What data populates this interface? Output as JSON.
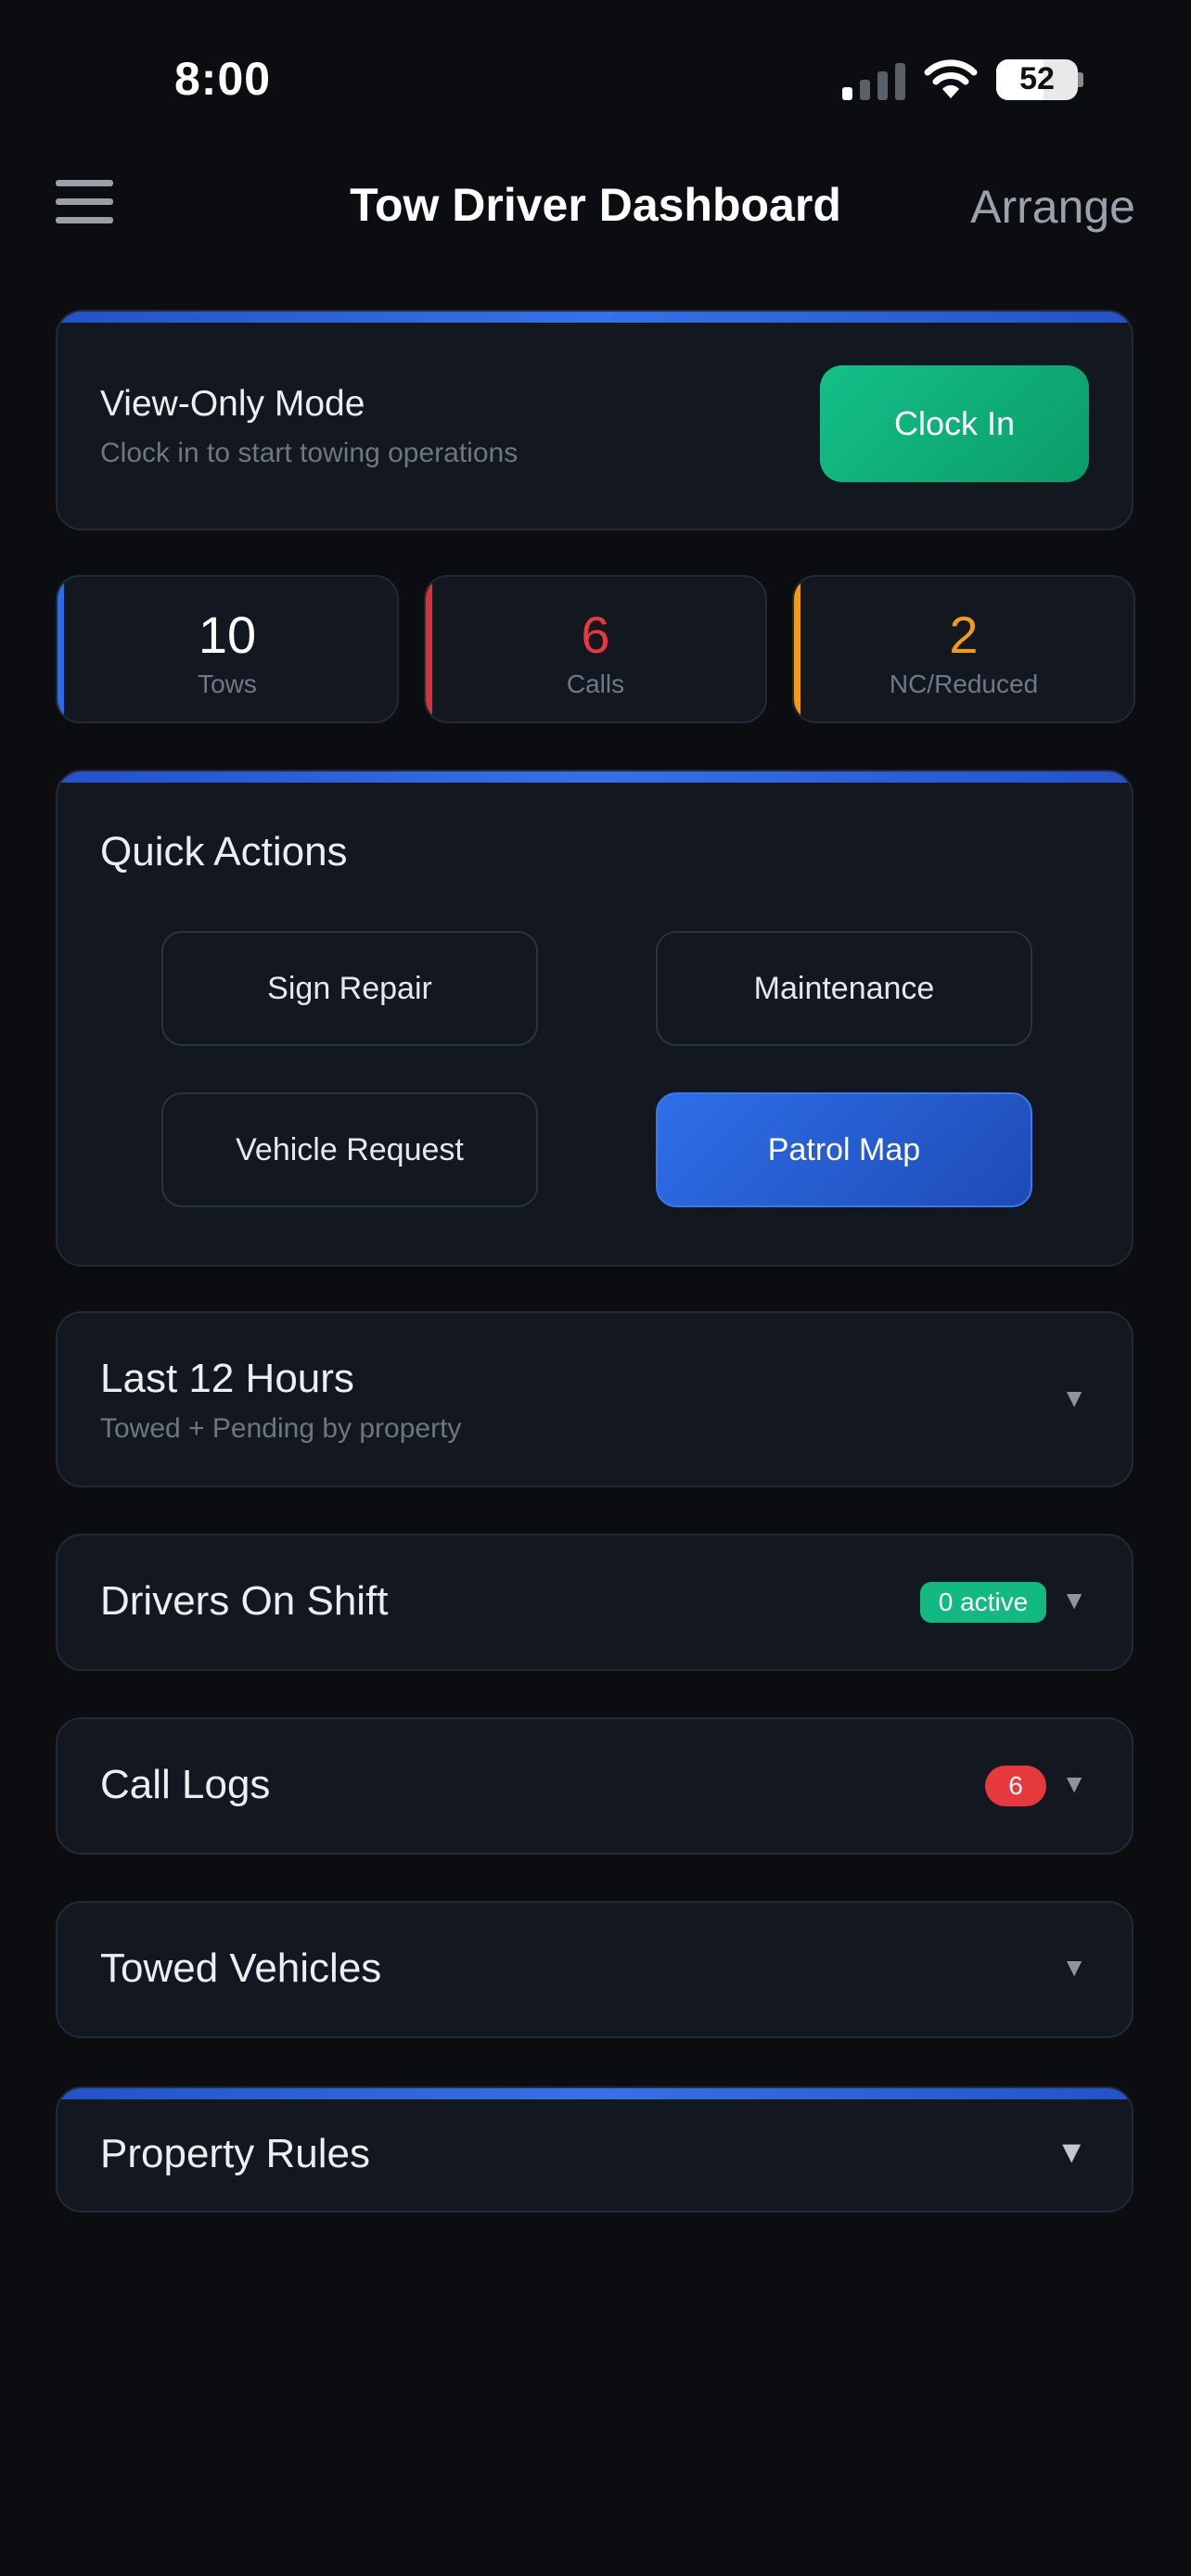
{
  "status_bar": {
    "time": "8:00",
    "battery": "52"
  },
  "header": {
    "title": "Tow Driver Dashboard",
    "arrange_label": "Arrange"
  },
  "mode_card": {
    "title": "View-Only Mode",
    "subtitle": "Clock in to start towing operations",
    "clock_in_label": "Clock In"
  },
  "stats": [
    {
      "value": "10",
      "label": "Tows",
      "color": "#ffffff",
      "accent": "#2f6be0"
    },
    {
      "value": "6",
      "label": "Calls",
      "color": "#e5393d",
      "accent": "#d83236"
    },
    {
      "value": "2",
      "label": "NC/Reduced",
      "color": "#f39a1a",
      "accent": "#f39a1a"
    }
  ],
  "quick_actions": {
    "title": "Quick Actions",
    "buttons": [
      "Sign Repair",
      "Maintenance",
      "Vehicle Request",
      "Patrol Map"
    ]
  },
  "sections": {
    "last12": {
      "title": "Last 12 Hours",
      "subtitle": "Towed + Pending by property"
    },
    "drivers": {
      "title": "Drivers On Shift",
      "badge": "0 active",
      "badge_color": "#12b981"
    },
    "call_logs": {
      "title": "Call Logs",
      "badge": "6",
      "badge_color": "#e5393d"
    },
    "towed": {
      "title": "Towed Vehicles"
    },
    "rules": {
      "title": "Property Rules"
    }
  },
  "icons": {
    "menu": "hamburger-icon",
    "chevron": "chevron-down-icon",
    "wifi": "wifi-icon",
    "signal": "signal-icon",
    "battery": "battery-icon"
  },
  "colors": {
    "accent": "#2f6be0",
    "success": "#12b981",
    "danger": "#e5393d",
    "warning": "#f39a1a",
    "background": "#0b0d11",
    "card": "#121720"
  }
}
